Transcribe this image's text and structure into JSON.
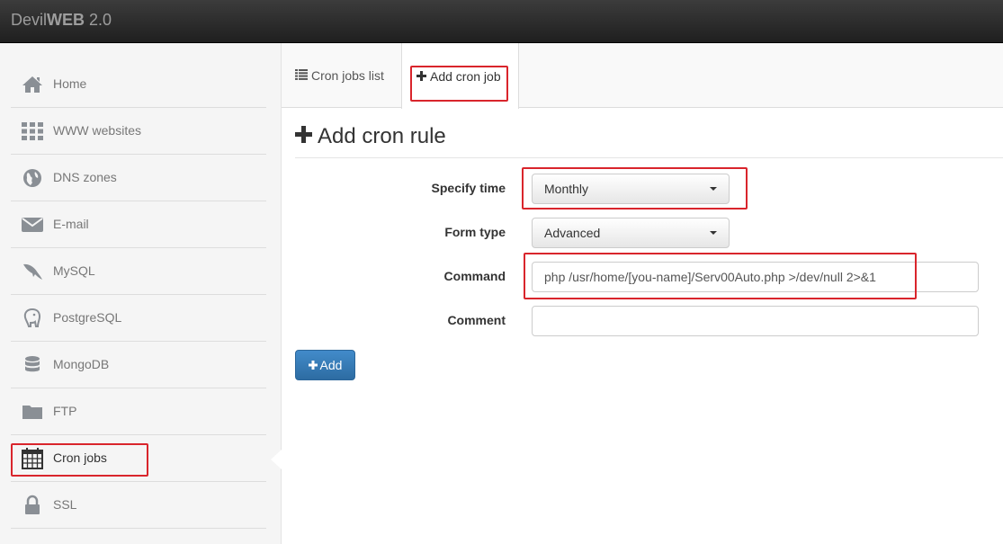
{
  "brand": {
    "prefix": "Devil",
    "bold": "WEB",
    "version": "2.0"
  },
  "sidebar": {
    "items": [
      {
        "label": "Home",
        "icon": "home-icon"
      },
      {
        "label": "WWW websites",
        "icon": "grid-icon"
      },
      {
        "label": "DNS zones",
        "icon": "globe-icon"
      },
      {
        "label": "E-mail",
        "icon": "envelope-icon"
      },
      {
        "label": "MySQL",
        "icon": "dolphin-icon"
      },
      {
        "label": "PostgreSQL",
        "icon": "elephant-icon"
      },
      {
        "label": "MongoDB",
        "icon": "database-icon"
      },
      {
        "label": "FTP",
        "icon": "folder-icon"
      },
      {
        "label": "Cron jobs",
        "icon": "calendar-icon",
        "active": true
      },
      {
        "label": "SSL",
        "icon": "lock-icon"
      }
    ]
  },
  "tabs": [
    {
      "label": "Cron jobs list",
      "icon": "list-icon"
    },
    {
      "label": "Add cron job",
      "icon": "plus-icon",
      "active": true
    }
  ],
  "form": {
    "title": "Add cron rule",
    "specify_time": {
      "label": "Specify time",
      "value": "Monthly"
    },
    "form_type": {
      "label": "Form type",
      "value": "Advanced"
    },
    "command": {
      "label": "Command",
      "value": "php /usr/home/[you-name]/Serv00Auto.php >/dev/null 2>&1"
    },
    "comment": {
      "label": "Comment",
      "value": ""
    },
    "submit_label": "Add"
  },
  "colors": {
    "accent": "#428bca",
    "highlight": "#d9252c",
    "topbar": "#222222"
  }
}
